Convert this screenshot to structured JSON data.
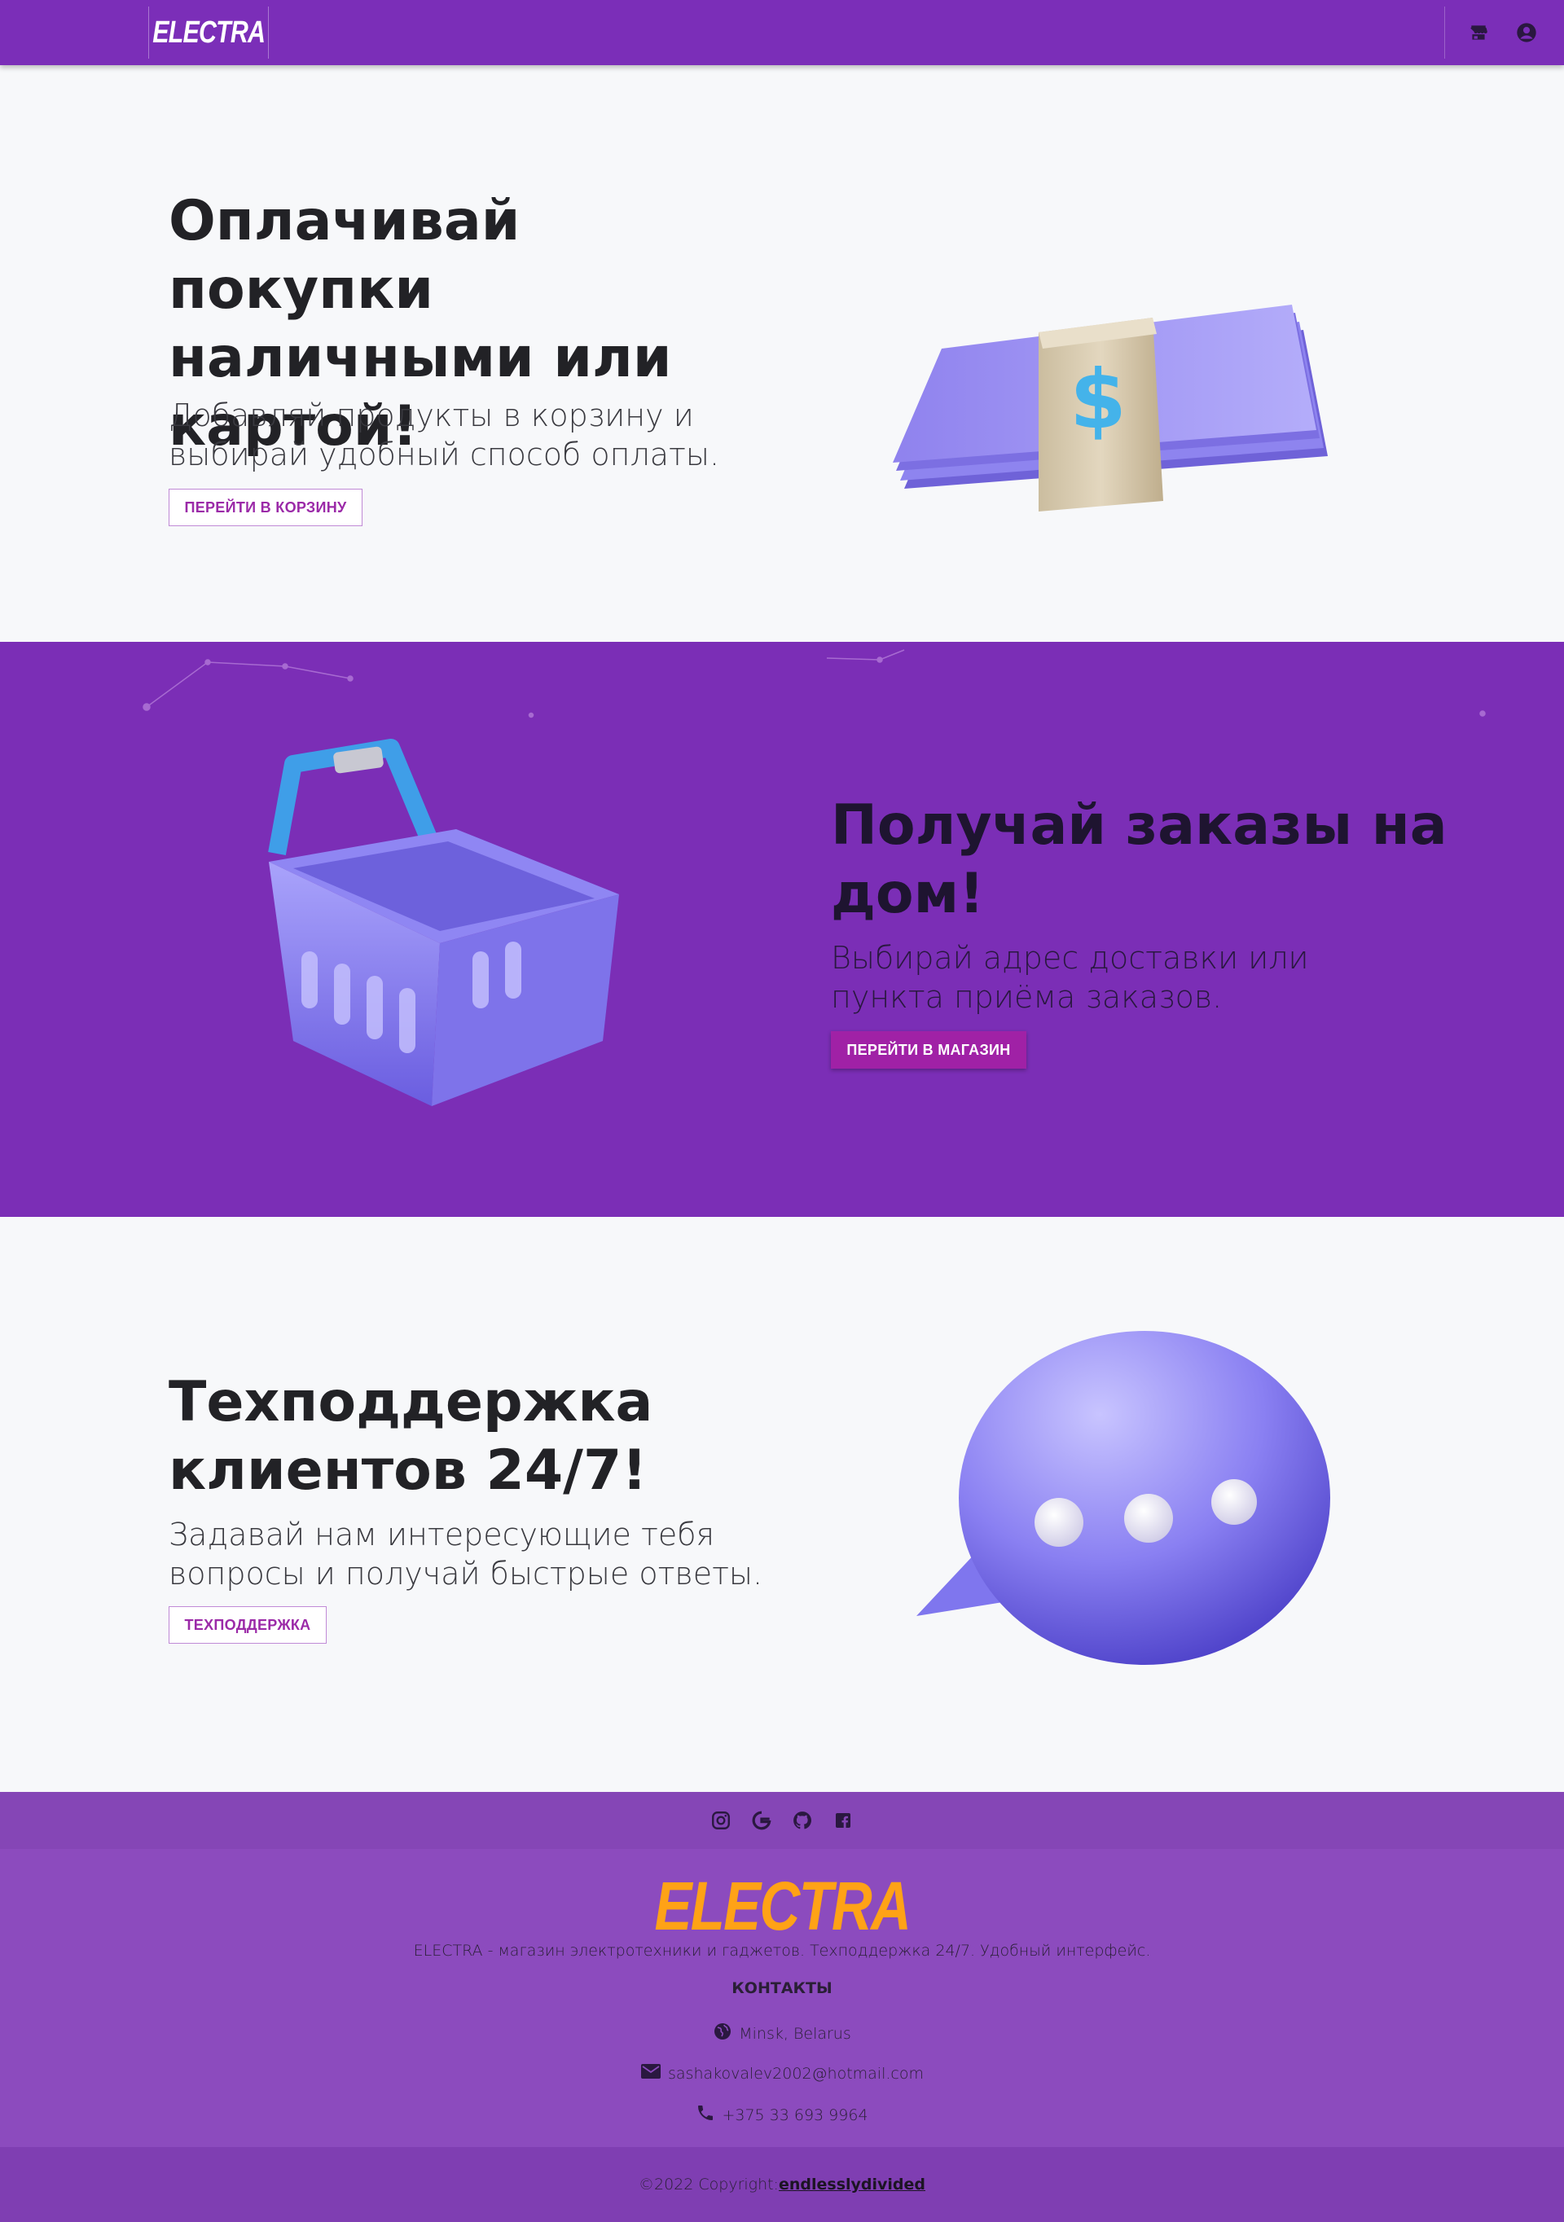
{
  "navbar": {
    "brand": "ELECTRA",
    "icons": [
      "store-icon",
      "account-circle-icon"
    ],
    "background": "#7b2eb8"
  },
  "sections": [
    {
      "title": "Оплачивай покупки наличными или картой!",
      "subtitle": "Добавляй продукты в корзину и выбирай удобный способ оплаты.",
      "button": "ПЕРЕЙТИ В КОРЗИНУ",
      "illustration": "money-stack-icon"
    },
    {
      "title": "Получай заказы на дом!",
      "subtitle": "Выбирай адрес доставки или пункта приёма заказов.",
      "button": "ПЕРЕЙТИ В МАГАЗИН",
      "illustration": "shopping-basket-icon"
    },
    {
      "title": "Техподдержка клиентов 24/7!",
      "subtitle": "Задавай нам интересующие тебя вопросы и получай быстрые ответы.",
      "button": "ТЕХПОДДЕРЖКА",
      "illustration": "chat-bubble-icon"
    }
  ],
  "footer": {
    "social_icons": [
      "instagram-icon",
      "google-icon",
      "github-icon",
      "facebook-icon"
    ],
    "logo": "ELECTRA",
    "description": "ELECTRA - магазин электротехники и гаджетов. Техподдержка 24/7. Удобный интерфейс.",
    "contacts_title": "КОНТАКТЫ",
    "location": "Minsk, Belarus",
    "email": "sashakovalev2002@hotmail.com",
    "phone": "+375 33 693 9964",
    "copyright_prefix": "©2022 Copyright:",
    "copyright_link": "endlesslydivided"
  },
  "colors": {
    "primary": "#7b2eb8",
    "accent_button": "#a021a6",
    "footer_logo": "#ffa216",
    "page_background": "#f7f8fa"
  }
}
